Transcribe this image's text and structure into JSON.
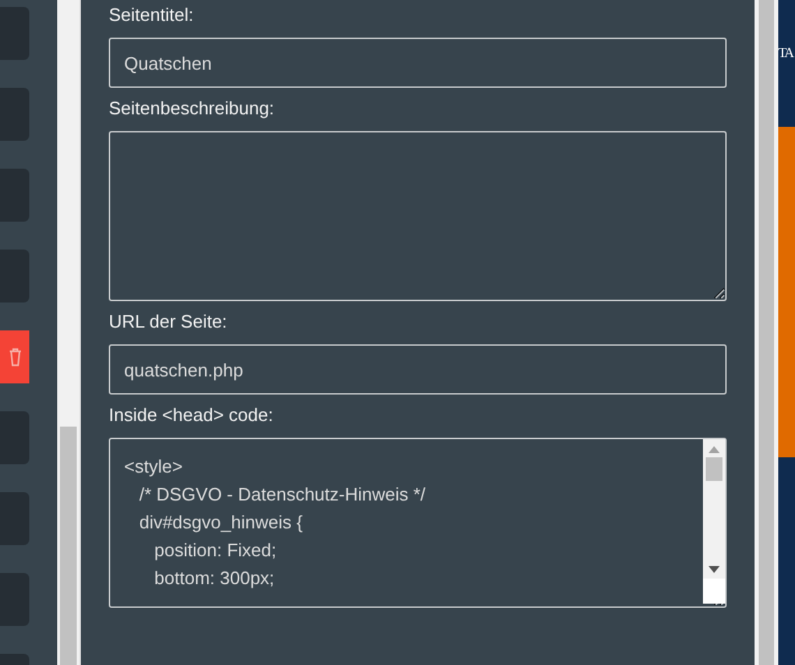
{
  "sidebar": {
    "items": [
      {
        "kind": "tile"
      },
      {
        "kind": "tile"
      },
      {
        "kind": "tile"
      },
      {
        "kind": "tile"
      },
      {
        "kind": "delete"
      },
      {
        "kind": "tile"
      },
      {
        "kind": "tile"
      },
      {
        "kind": "tile"
      },
      {
        "kind": "tile"
      }
    ]
  },
  "form": {
    "fields": [
      {
        "kind": "input",
        "label": "Seitentitel:",
        "value": "Quatschen"
      },
      {
        "kind": "textarea",
        "label": "Seitenbeschreibung:"
      },
      {
        "kind": "input",
        "label": "URL der Seite:",
        "value": "quatschen.php"
      },
      {
        "kind": "code",
        "label": "Inside <head> code:",
        "lines": [
          "<style>",
          "   /* DSGVO - Datenschutz-Hinweis */",
          "   div#dsgvo_hinweis {",
          "      position: Fixed;",
          "      bottom: 300px;"
        ]
      }
    ]
  },
  "background_page": {
    "heading": "TA"
  }
}
